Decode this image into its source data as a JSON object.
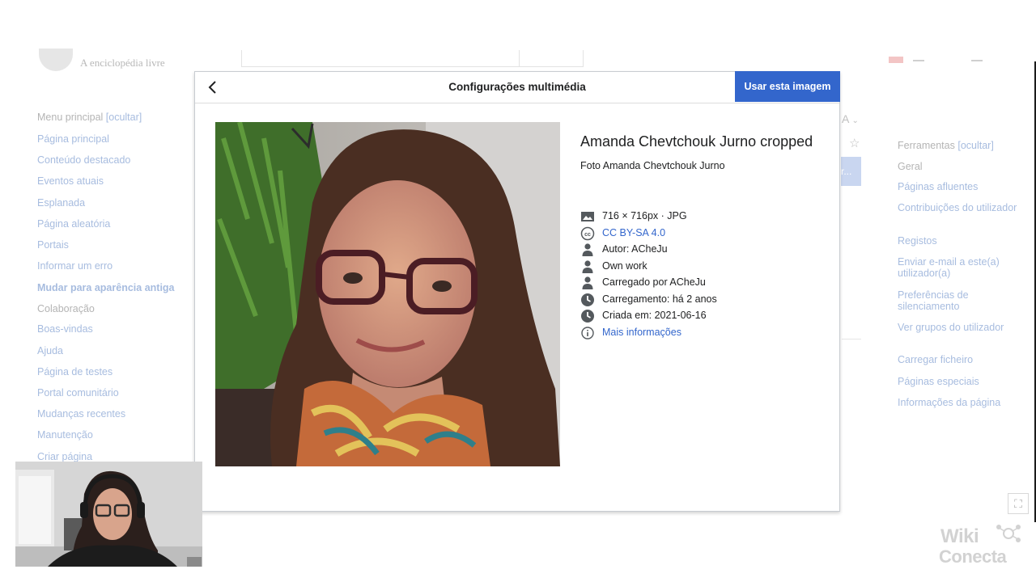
{
  "background": {
    "tagline": "A enciclopédia livre",
    "left_menu": {
      "heading": "Menu principal",
      "hide_label": "[ocultar]",
      "items": [
        "Página principal",
        "Conteúdo destacado",
        "Eventos atuais",
        "Esplanada",
        "Página aleatória",
        "Portais",
        "Informar um erro",
        "Mudar para aparência antiga",
        "Colaboração",
        "Boas-vindas",
        "Ajuda",
        "Página de testes",
        "Portal comunitário",
        "Mudanças recentes",
        "Manutenção",
        "Criar página"
      ]
    },
    "right_menu": {
      "heading": "Ferramentas",
      "hide_label": "[ocultar]",
      "items": [
        "Geral",
        "Páginas afluentes",
        "Contribuições do utilizador",
        "Registos",
        "Enviar e-mail a este(a) utilizador(a)",
        "Preferências de silenciamento",
        "Ver grupos do utilizador",
        "Carregar ficheiro",
        "Páginas especiais",
        "Informações da página"
      ]
    },
    "lang_letter": "A",
    "star_glyph": "☆",
    "blue_button_label": "r...",
    "fullscreen_glyph": "⛶"
  },
  "dialog": {
    "title": "Configurações multimédia",
    "primary_button": "Usar esta imagem",
    "file_name": "Amanda Chevtchouk Jurno cropped",
    "description": "Foto Amanda Chevtchouk Jurno",
    "meta": [
      {
        "icon": "image-icon",
        "text": "716 × 716px · JPG",
        "link": false
      },
      {
        "icon": "cc-license-icon",
        "text": "CC BY-SA 4.0",
        "link": true
      },
      {
        "icon": "user-icon",
        "text": "Autor: ACheJu",
        "link": false
      },
      {
        "icon": "user-icon",
        "text": "Own work",
        "link": false
      },
      {
        "icon": "user-icon",
        "text": "Carregado por ACheJu",
        "link": false
      },
      {
        "icon": "clock-icon",
        "text": "Carregamento: há 2 anos",
        "link": false
      },
      {
        "icon": "clock-icon",
        "text": "Criada em: 2021-06-16",
        "link": false
      },
      {
        "icon": "info-icon",
        "text": "Mais informações",
        "link": true
      }
    ]
  },
  "watermark": {
    "line1": "Wiki",
    "line2": "Conecta"
  },
  "colors": {
    "accent": "#3366cc",
    "link": "#3366cc",
    "faded_link": "#a7bcdf"
  }
}
